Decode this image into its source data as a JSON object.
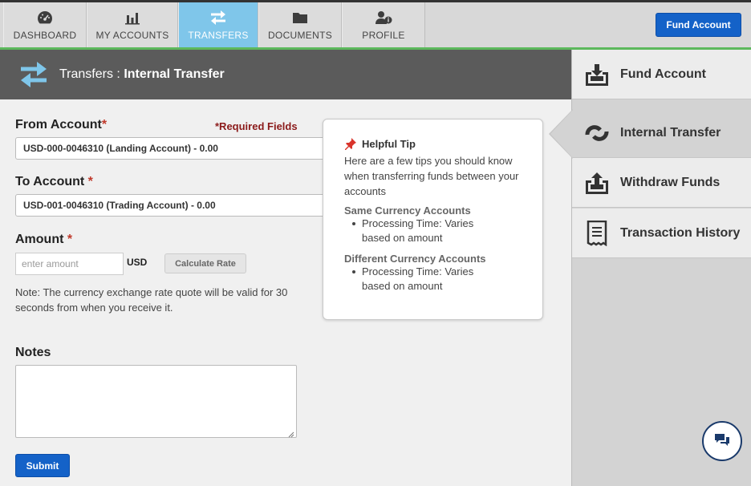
{
  "nav": {
    "tabs": [
      {
        "label": "DASHBOARD",
        "icon": "dashboard-icon"
      },
      {
        "label": "MY ACCOUNTS",
        "icon": "bar-chart-icon"
      },
      {
        "label": "TRANSFERS",
        "icon": "transfer-arrows-icon",
        "active": true
      },
      {
        "label": "DOCUMENTS",
        "icon": "folder-icon"
      },
      {
        "label": "PROFILE",
        "icon": "user-info-icon"
      }
    ],
    "fund_button": "Fund Account"
  },
  "header": {
    "section": "Transfers",
    "separator": " : ",
    "page": "Internal Transfer"
  },
  "form": {
    "from_label": "From Account",
    "from_req": "*",
    "required_fields": "*Required Fields",
    "from_value": "USD-000-0046310 (Landing Account) - 0.00",
    "to_label": "To Account",
    "to_req": " *",
    "to_value": "USD-001-0046310 (Trading Account) - 0.00",
    "amount_label": "Amount",
    "amount_req": " *",
    "amount_placeholder": "enter amount",
    "currency": "USD",
    "calc_button": "Calculate Rate",
    "note": "Note: The currency exchange rate quote will be valid for 30 seconds from when you receive it.",
    "notes_label": "Notes",
    "notes_value": "",
    "submit": "Submit"
  },
  "tip": {
    "title": "Helpful Tip",
    "intro": "Here are a few tips you should know when transferring funds between your accounts",
    "same_title": "Same Currency Accounts",
    "same_item": "Processing Time: Varies based on amount",
    "diff_title": "Different Currency Accounts",
    "diff_item": "Processing Time: Varies based on amount"
  },
  "sidebar": {
    "items": [
      {
        "label": "Fund Account",
        "icon": "fund-download-icon"
      },
      {
        "label": "Internal Transfer",
        "icon": "internal-transfer-icon",
        "active": true
      },
      {
        "label": "Withdraw Funds",
        "icon": "withdraw-upload-icon"
      },
      {
        "label": "Transaction History",
        "icon": "receipt-icon"
      }
    ]
  },
  "colors": {
    "accent_blue": "#1462c8",
    "active_tab": "#7fc6ea",
    "green_bar": "#5cb85c",
    "required_red": "#c0392b"
  }
}
